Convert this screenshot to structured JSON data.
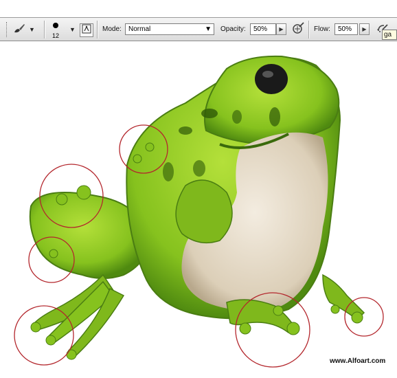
{
  "toolbar": {
    "brush_size": "12",
    "mode_label": "Mode:",
    "mode_value": "Normal",
    "opacity_label": "Opacity:",
    "opacity_value": "50%",
    "flow_label": "Flow:",
    "flow_value": "50%",
    "tooltip_text": "ga",
    "icons": [
      "brush-tool-icon",
      "brush-preset-icon",
      "brush-panel-toggle-icon",
      "opacity-pressure-icon",
      "airbrush-icon"
    ]
  },
  "canvas": {
    "subject": "green frog illustration with highlighted toes",
    "watermark": "www.Alfoart.com",
    "colors": {
      "frog_green": "#86c21e",
      "belly": "#e6dbc8",
      "circles": "#b3262c"
    }
  }
}
